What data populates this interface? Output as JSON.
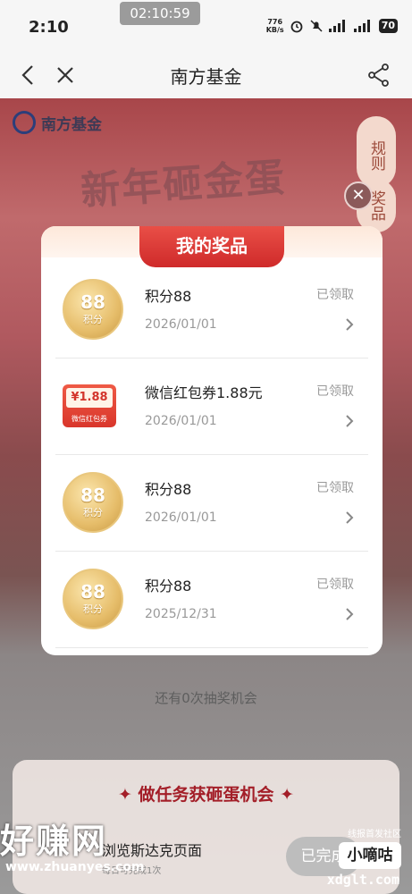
{
  "status_bar": {
    "time": "2:10",
    "recording_time": "02:10:59",
    "net_speed_value": "776",
    "net_speed_unit": "KB/s",
    "battery": "70"
  },
  "nav": {
    "title": "南方基金"
  },
  "background": {
    "brand_name": "南方基金",
    "headline": "新年砸金蛋",
    "rule_label": "规则",
    "prize_label": "奖品",
    "chances_text": "还有0次抽奖机会"
  },
  "modal": {
    "title": "我的奖品",
    "items": [
      {
        "type": "coin",
        "coin_value": "88",
        "coin_unit": "积分",
        "name": "积分88",
        "status": "已领取",
        "date": "2026/01/01"
      },
      {
        "type": "coupon",
        "coupon_amount": "¥1.88",
        "coupon_label": "微信红包券",
        "name": "微信红包券1.88元",
        "status": "已领取",
        "date": "2026/01/01"
      },
      {
        "type": "coin",
        "coin_value": "88",
        "coin_unit": "积分",
        "name": "积分88",
        "status": "已领取",
        "date": "2026/01/01"
      },
      {
        "type": "coin",
        "coin_value": "88",
        "coin_unit": "积分",
        "name": "积分88",
        "status": "已领取",
        "date": "2025/12/31"
      }
    ]
  },
  "task_section": {
    "title": "做任务获砸蛋机会",
    "task_name": "浏览斯达克页面",
    "task_desc": "每日可完成1次",
    "button_label": "已完成"
  },
  "watermark": {
    "main": "好赚网",
    "url": "www.zhuanyes.com",
    "side_small": "线报首发社区",
    "side_box": "小嘀咕",
    "side_url": "xdglt.com"
  },
  "colors": {
    "accent_red": "#cf2a2a",
    "gold": "#e6bd6a"
  }
}
